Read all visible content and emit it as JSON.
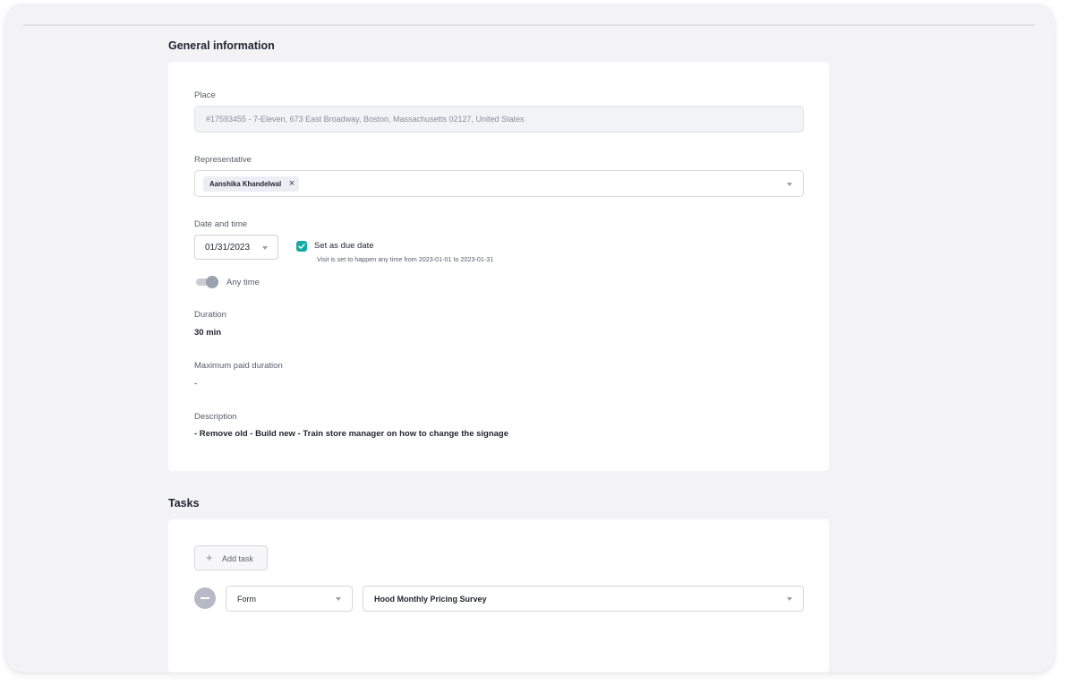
{
  "general": {
    "title": "General information",
    "place": {
      "label": "Place",
      "value": "#17593455 - 7-Eleven, 673 East Broadway, Boston, Massachusetts 02127, United States"
    },
    "representative": {
      "label": "Representative",
      "chip": "Aanshika Khandelwal"
    },
    "date_time": {
      "label": "Date and time",
      "date": "01/31/2023",
      "due_label": "Set as due date",
      "due_checked": true,
      "due_hint": "Visit is set to happen any time from 2023-01-01 to 2023-01-31",
      "any_time_label": "Any time"
    },
    "duration": {
      "label": "Duration",
      "value": "30 min"
    },
    "max_paid": {
      "label": "Maximum paid duration",
      "value": "-"
    },
    "description": {
      "label": "Description",
      "value": "- Remove old - Build new - Train store manager on how to change the signage"
    }
  },
  "tasks": {
    "title": "Tasks",
    "add_label": "Add task",
    "items": [
      {
        "type": "Form",
        "name": "Hood Monthly Pricing Survey"
      }
    ]
  },
  "colors": {
    "accent": "#15a9a3",
    "background": "#f3f3f6",
    "card": "#ffffff"
  }
}
